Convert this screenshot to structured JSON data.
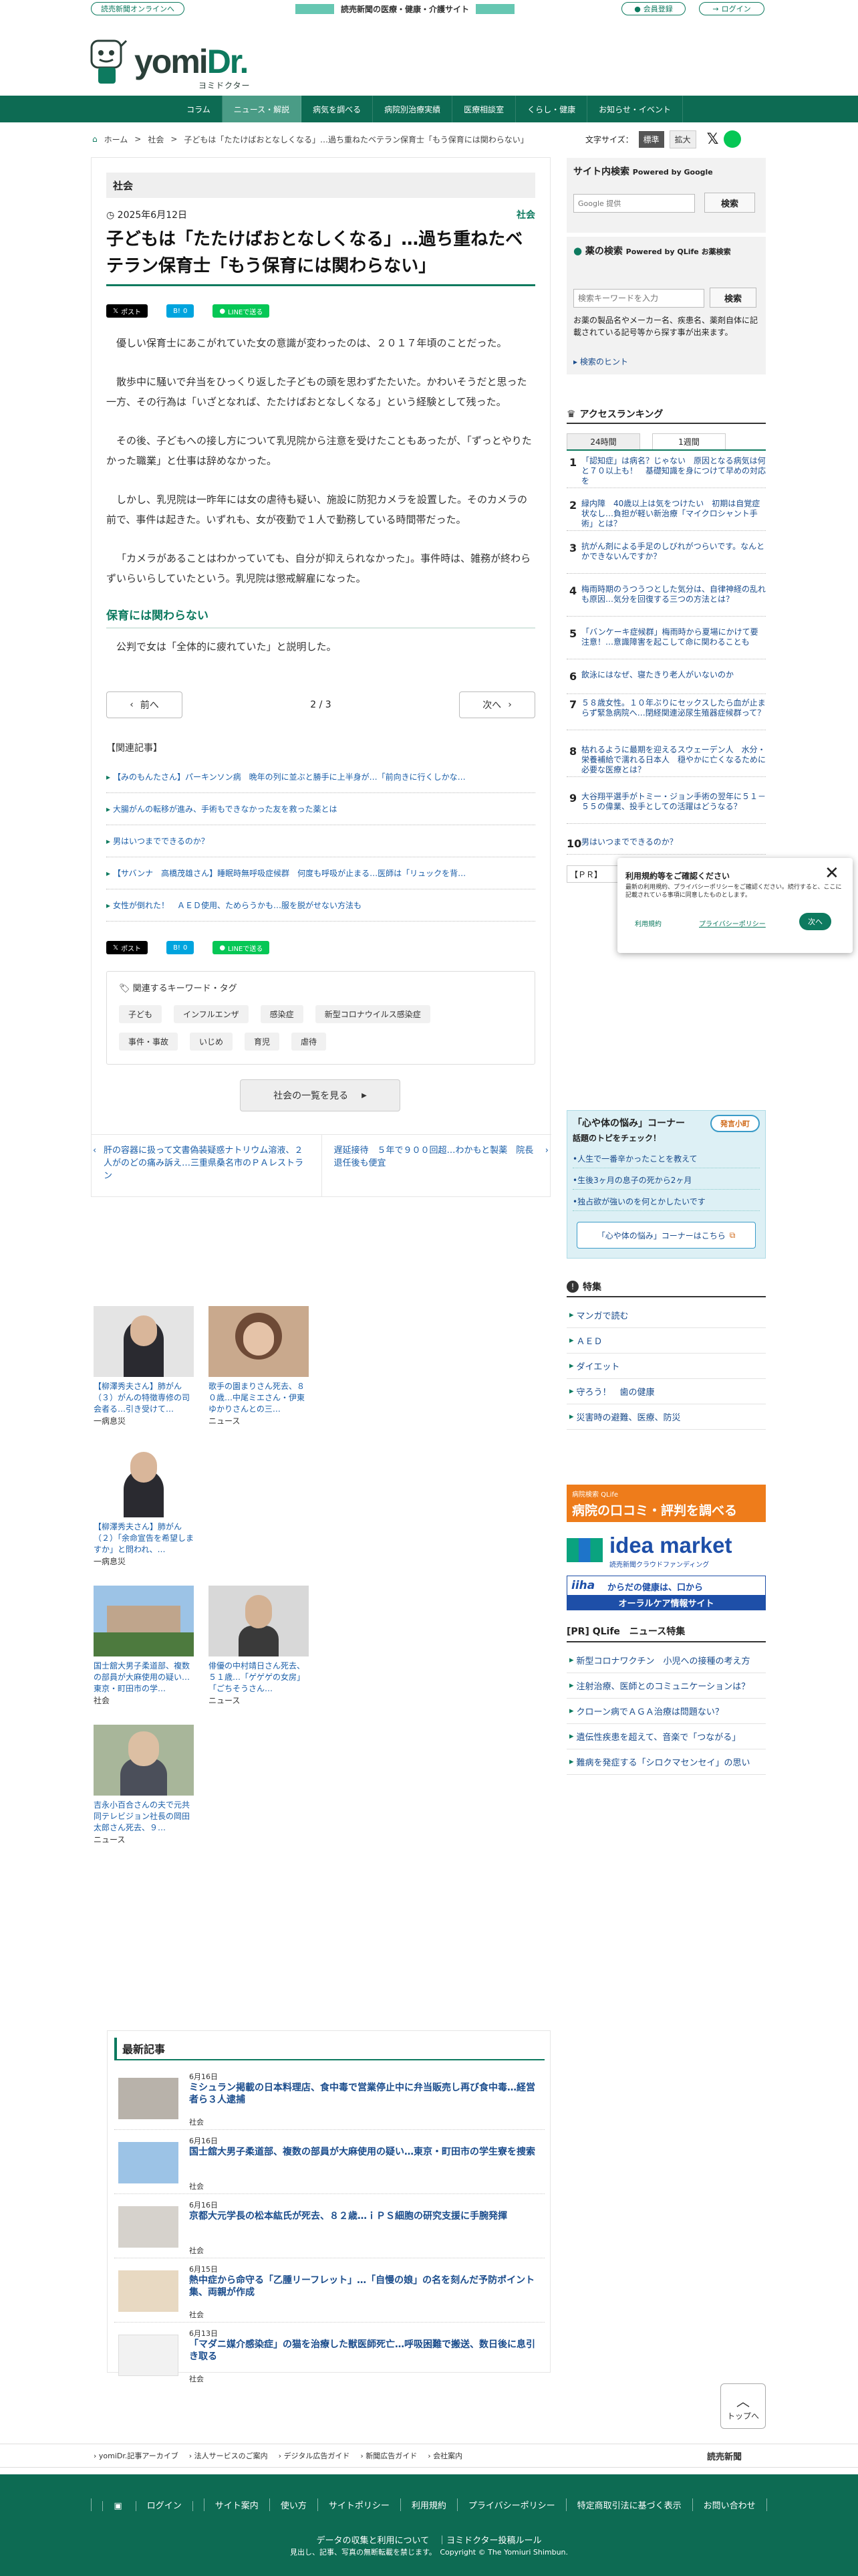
{
  "topbar": {
    "online": "読売新聞オンラインへ",
    "tagline": "読売新聞の医療・健康・介護サイト",
    "register": "会員登録",
    "login": "ログイン"
  },
  "logo": {
    "word_a": "yomi",
    "word_b": "Dr.",
    "sub": "ヨミドクター"
  },
  "nav": [
    "コラム",
    "ニュース・解説",
    "病気を調べる",
    "病院別治療実績",
    "医療相談室",
    "くらし・健康",
    "お知らせ・イベント"
  ],
  "breadcrumb": [
    "ホーム",
    "社会",
    "子どもは「たたけばおとなしくなる」…過ち重ねたベテラン保育士「もう保育には関わらない」"
  ],
  "fontsize": {
    "label": "文字サイズ：",
    "std": "標準",
    "large": "拡大"
  },
  "article": {
    "category_bar": "社会",
    "date": "2025年6月12日",
    "category": "社会",
    "headline": "子どもは「たたけばおとなしくなる」…過ち重ねたベテラン保育士「もう保育には関わらない」",
    "share": {
      "post": "ポスト",
      "hatena": "0",
      "line": "LINEで送る"
    },
    "paragraphs": [
      "優しい保育士にあこがれていた女の意識が変わったのは、２０１７年頃のことだった。",
      "散歩中に騒いで弁当をひっくり返した子どもの頭を思わずたたいた。かわいそうだと思った一方、その行為は「いざとなれば、たたけばおとなしくなる」という経験として残った。",
      "その後、子どもへの接し方について乳児院から注意を受けたこともあったが、「ずっとやりたかった職業」と仕事は辞めなかった。",
      "しかし、乳児院は一昨年には女の虐待も疑い、施設に防犯カメラを設置した。そのカメラの前で、事件は起きた。いずれも、女が夜勤で１人で勤務している時間帯だった。",
      "「カメラがあることはわかっていても、自分が抑えられなかった」。事件時は、雑務が終わらずいらいらしていたという。乳児院は懲戒解雇になった。"
    ],
    "subhead": "保育には関わらない",
    "paragraph_after": "公判で女は「全体的に疲れていた」と説明した。",
    "pager": {
      "prev": "前へ",
      "page": "2 / 3",
      "next": "次へ"
    },
    "related_heading": "【関連記事】",
    "related": [
      "【みのもんたさん】パーキンソン病　晩年の列に並ぶと勝手に上半身が…「前向きに行くしかな…",
      "大腸がんの転移が進み、手術もできなかった友を救った薬とは",
      "男はいつまでできるのか？",
      "【サバンナ　高橋茂雄さん】睡眠時無呼吸症候群　何度も呼吸が止まる…医師は「リュックを背…",
      "女性が倒れた！　ＡＥＤ使用、ためらうかも…服を脱がせない方法も"
    ],
    "keywords_heading": "関連するキーワード・タグ",
    "keywords": [
      "子ども",
      "インフルエンザ",
      "感染症",
      "新型コロナウイルス感染症",
      "事件・事故",
      "いじめ",
      "育児",
      "虐待"
    ],
    "list_button": "社会の一覧を見る",
    "prev_article": "肝の容器に扱って文書偽装疑惑ナトリウム溶液、２人がのどの痛み訴え…三重県桑名市のＰＡレストラン",
    "next_article": "遅延接待　５年で９００回超…わかもと製薬　院長退任後も便宜"
  },
  "thumbs": [
    {
      "caption": "【柳澤秀夫さん】肺がん（３）がんの特徴専修の司会者る…引き受けて…",
      "cat": "一病息災"
    },
    {
      "caption": "歌手の園まりさん死去、８０歳…中尾ミエさん・伊東ゆかりさんとの三…",
      "cat": "ニュース"
    },
    {
      "caption": "【柳澤秀夫さん】肺がん（２）「余命宣告を希望しますか」と問われ、…",
      "cat": "一病息災"
    },
    {
      "caption": "国士舘大男子柔道部、複数の部員が大麻使用の疑い…東京・町田市の学…",
      "cat": "社会"
    },
    {
      "caption": "俳優の中村靖日さん死去、５１歳…「ゲゲゲの女房」「ごちそうさん…",
      "cat": "ニュース"
    },
    {
      "caption": "吉永小百合さんの夫で元共同テレビジョン社長の岡田太郎さん死去、９…",
      "cat": "ニュース"
    }
  ],
  "latest": {
    "heading": "最新記事",
    "items": [
      {
        "date": "6月16日",
        "title": "ミシュラン掲載の日本料理店、食中毒で営業停止中に弁当販売し再び食中毒…経営者ら３人逮捕",
        "cat": "社会"
      },
      {
        "date": "6月16日",
        "title": "国士舘大男子柔道部、複数の部員が大麻使用の疑い…東京・町田市の学生寮を捜索",
        "cat": "社会"
      },
      {
        "date": "6月16日",
        "title": "京都大元学長の松本紘氏が死去、８２歳…ｉＰＳ細胞の研究支援に手腕発揮",
        "cat": "社会"
      },
      {
        "date": "6月15日",
        "title": "熱中症から命守る「乙腫リーフレット」…「自慢の娘」の名を刻んだ予防ポイント集、両親が作成",
        "cat": "社会"
      },
      {
        "date": "6月13日",
        "title": "「マダニ媒介感染症」の猫を治療した獣医師死亡…呼吸困難で搬送、数日後に息引き取る",
        "cat": "社会"
      }
    ]
  },
  "sidebar": {
    "search_title": "サイト内検索",
    "search_by": "Powered by Google",
    "search_placeholder": "Google 提供",
    "search_button": "検索",
    "drug_title": "薬の検索",
    "drug_by": "Powered by QLife お薬検索",
    "drug_placeholder": "検索キーワードを入力",
    "drug_button": "検索",
    "drug_desc": "お薬の製品名やメーカー名、疾患名、薬剤自体に記載されている記号等から探す事が出来ます。",
    "drug_hint": "検索のヒント",
    "ranking_title": "アクセスランキング",
    "ranking_tabs": [
      "24時間",
      "1週間"
    ],
    "ranking": [
      "「認知症」は病名？じゃない　原因となる病気は何と７０以上も！　基礎知識を身につけて早めの対応を",
      "緑内障　40歳以上は気をつけたい　初期は自覚症状なし…負担が軽い新治療「マイクロシャント手術」とは？",
      "抗がん剤による手足のしびれがつらいです。なんとかできないんですか？",
      "梅雨時期のうつうつとした気分は、自律神経の乱れも原因…気分を回復する三つの方法とは？",
      "「バンケーキ症候群」梅雨時から夏場にかけて要注意！…意識障害を起こして命に関わることも",
      "飲泳にはなぜ、寝たきり老人がいないのか",
      "５８歳女性。１０年ぶりにセックスしたら血が止まらず緊急病院へ…閉経関連泌尿生殖器症候群って？",
      "枯れるように最期を迎えるスウェーデン人　水分・栄養補給で濡れる日本人　穏やかに亡くなるために必要な医療とは？",
      "大谷翔平選手がトミー・ジョン手術の翌年に５１－５５の偉業、投手としての活躍はどうなる？",
      "男はいつまでできるのか？"
    ],
    "pr_label": "【ＰＲ】",
    "popup": {
      "title": "利用規約等をご確認ください",
      "body": "最新の利用規約、プライバシーポリシーをご確認ください。続行すると、ここに記載されている事項に同意したものとします。",
      "terms": "利用規約",
      "privacy": "プライバシーポリシー",
      "next": "次へ"
    },
    "nayami_title": "「心や体の悩み」コーナー",
    "nayami_badge": "発言小町",
    "nayami_sub": "話題のトピをチェック！",
    "nayami_items": [
      "人生で一番辛かったことを教えて",
      "生後3ヶ月の息子の死から2ヶ月",
      "独占欲が強いのを何とかしたいです"
    ],
    "nayami_link": "「心や体の悩み」コーナーはこちら",
    "feature_title": "特集",
    "features": [
      "マンガで読む",
      "ＡＥＤ",
      "ダイエット",
      "守ろう！　歯の健康",
      "災害時の避難、医療、防災"
    ],
    "banner1": "病院の口コミ・評判を調べる",
    "banner1_small": "病院検索 QLife",
    "banner2": "idea market",
    "banner2_sub": "読売新聞クラウドファンディング",
    "banner3": "からだの健康は、口から",
    "banner3_sub": "オーラルケア情報サイト",
    "qlife_title": "[PR]  QLife　ニュース特集",
    "qlife": [
      "新型コロナワクチン　小児への接種の考え方",
      "注射治療、医師とのコミュニケーションは？",
      "クローン病でＡＧＡ治療は問題ない？",
      "遺伝性疾患を超えて、音楽で「つながる」",
      "難病を発症する「シロクマセンセイ」の思い"
    ]
  },
  "footer": {
    "sublinks": [
      "yomiDr.記事アーカイブ",
      "法人サービスのご案内",
      "デジタル広告ガイド",
      "新聞広告ガイド",
      "会社案内"
    ],
    "brand": "読売新聞",
    "links": [
      "ログイン",
      "サイト案内",
      "使い方",
      "サイトポリシー",
      "利用規約",
      "プライバシーポリシー",
      "特定商取引法に基づく表示",
      "お問い合わせ"
    ],
    "data_policy": "データの収集と利用について　｜ヨミドクター投稿ルール",
    "copyright": "見出し、記事、写真の無断転載を禁じます。　Copyright © The Yomiuri Shimbun.",
    "top_label": "トップへ"
  },
  "colors": {
    "brand": "#0d6b53",
    "accent": "#0d7a5f",
    "link": "#1a5ea8"
  }
}
